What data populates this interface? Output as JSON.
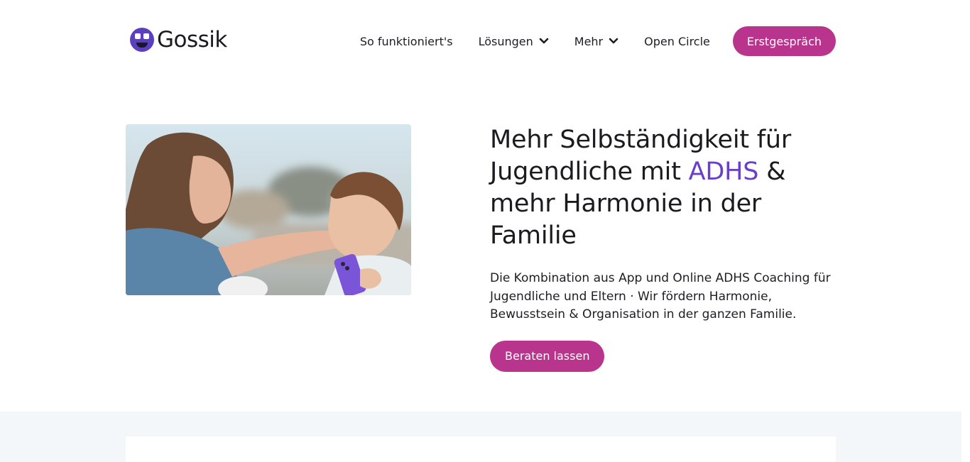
{
  "header": {
    "logo_text": "Gossik",
    "nav": [
      {
        "label": "So funktioniert's",
        "dropdown": false
      },
      {
        "label": "Lösungen",
        "dropdown": true
      },
      {
        "label": "Mehr",
        "dropdown": true
      },
      {
        "label": "Open Circle",
        "dropdown": false
      }
    ],
    "cta_label": "Erstgespräch"
  },
  "hero": {
    "headline_before": "Mehr Selbständigkeit für Jugendliche mit ",
    "headline_accent": "ADHS",
    "headline_after": " & mehr Harmonie in der Familie",
    "subtext": "Die Kombination aus App und Online ADHS Coaching für Jugendliche und Eltern · Wir fördern Harmonie, Bewusstsein & Organisation in der ganzen Familie.",
    "button_label": "Beraten lassen"
  },
  "colors": {
    "brand_pink": "#b9348c",
    "accent_purple": "#6a3fc9",
    "band_bg": "#f3f7f9"
  }
}
